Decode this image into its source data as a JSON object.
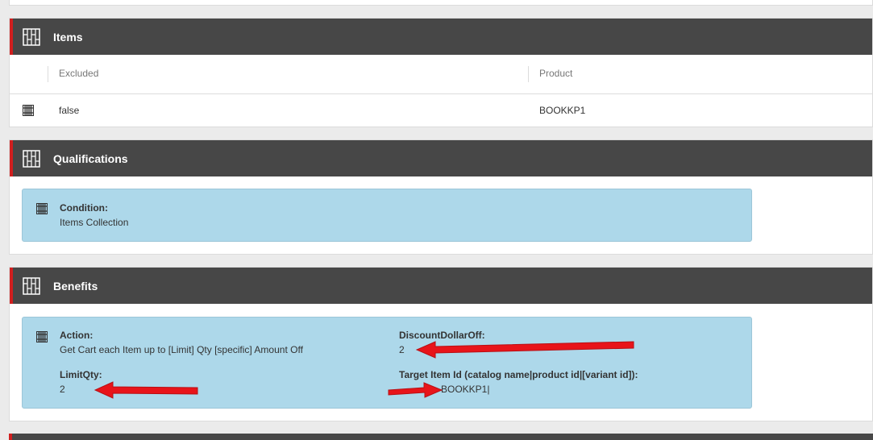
{
  "items_section": {
    "title": "Items",
    "columns": [
      "Excluded",
      "Product"
    ],
    "rows": [
      {
        "excluded": "false",
        "product": "BOOKKP1"
      }
    ]
  },
  "qualifications_section": {
    "title": "Qualifications",
    "condition_label": "Condition:",
    "condition_value": "Items Collection"
  },
  "benefits_section": {
    "title": "Benefits",
    "action_label": "Action:",
    "action_value": "Get Cart each Item up to [Limit] Qty [specific] Amount Off",
    "discount_label": "DiscountDollarOff:",
    "discount_value": "2",
    "limit_label": "LimitQty:",
    "limit_value": "2",
    "target_label": "Target Item Id (catalog name|product id|[variant id]):",
    "target_value": "BOOKKP1|"
  },
  "colors": {
    "header_bg": "#474747",
    "accent_red": "#d11f1f",
    "info_box_bg": "#add8ea",
    "annotation_arrow": "#e8141a"
  },
  "icons": [
    "grid-icon",
    "row-grid-icon",
    "annotation-arrow"
  ]
}
